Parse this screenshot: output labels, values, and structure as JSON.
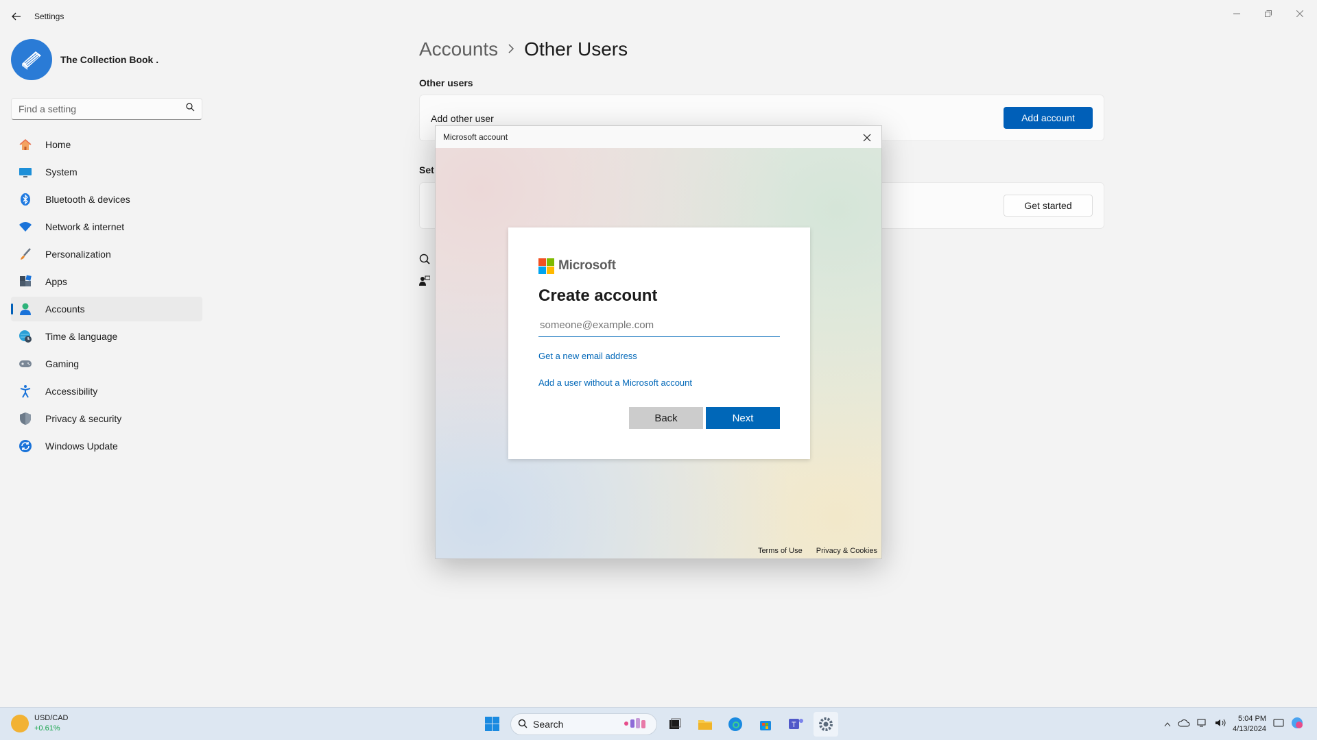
{
  "app": {
    "title": "Settings",
    "user_name": "The Collection Book ."
  },
  "sidebar": {
    "search_placeholder": "Find a setting",
    "items": [
      {
        "label": "Home",
        "icon": "home-icon"
      },
      {
        "label": "System",
        "icon": "system-icon"
      },
      {
        "label": "Bluetooth & devices",
        "icon": "bluetooth-icon"
      },
      {
        "label": "Network & internet",
        "icon": "wifi-icon"
      },
      {
        "label": "Personalization",
        "icon": "brush-icon"
      },
      {
        "label": "Apps",
        "icon": "apps-icon"
      },
      {
        "label": "Accounts",
        "icon": "accounts-icon",
        "active": true
      },
      {
        "label": "Time & language",
        "icon": "globe-clock-icon"
      },
      {
        "label": "Gaming",
        "icon": "gamepad-icon"
      },
      {
        "label": "Accessibility",
        "icon": "accessibility-icon"
      },
      {
        "label": "Privacy & security",
        "icon": "shield-icon"
      },
      {
        "label": "Windows Update",
        "icon": "update-icon"
      }
    ]
  },
  "main": {
    "breadcrumb_parent": "Accounts",
    "breadcrumb_current": "Other Users",
    "section_other_users": "Other users",
    "add_other_user_label": "Add other user",
    "add_account_button": "Add account",
    "section_set_partial": "Set",
    "get_started_button": "Get started"
  },
  "dialog": {
    "title": "Microsoft account",
    "brand": "Microsoft",
    "heading": "Create account",
    "email_placeholder": "someone@example.com",
    "link_new_email": "Get a new email address",
    "link_no_ms_account": "Add a user without a Microsoft account",
    "back_button": "Back",
    "next_button": "Next",
    "footer_terms": "Terms of Use",
    "footer_privacy": "Privacy & Cookies"
  },
  "taskbar": {
    "widget_title": "USD/CAD",
    "widget_value": "+0.61%",
    "search_label": "Search",
    "time": "5:04 PM",
    "date": "4/13/2024"
  },
  "colors": {
    "accent": "#005fb8",
    "ms_blue": "#0067b8",
    "ms_red": "#f25022",
    "ms_green": "#7fba00",
    "ms_blue_logo": "#00a4ef",
    "ms_yellow": "#ffb900"
  }
}
